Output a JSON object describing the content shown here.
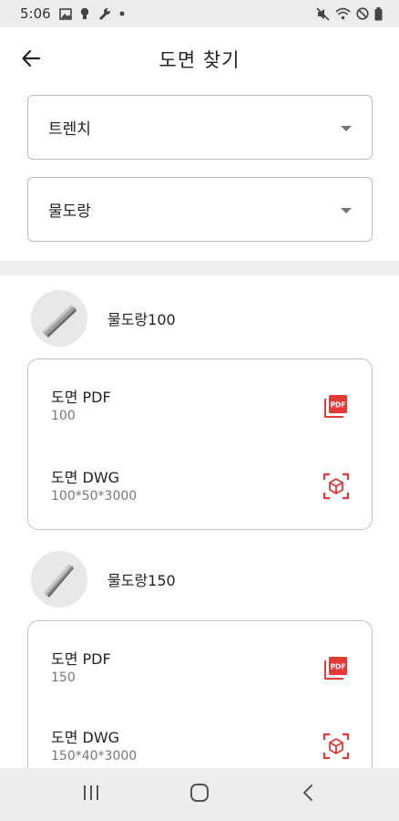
{
  "status": {
    "time": "5:06",
    "left_icons": [
      "image-icon",
      "bulb-icon",
      "wrench-icon",
      "dot-icon"
    ],
    "right_icons": [
      "mute-icon",
      "wifi-icon",
      "dnd-icon",
      "battery-icon"
    ]
  },
  "header": {
    "title": "도면 찾기",
    "back_icon": "arrow-left-icon"
  },
  "filters": {
    "category": "트렌치",
    "subcategory": "물도랑"
  },
  "products": [
    {
      "name": "물도랑100",
      "files": [
        {
          "title": "도면 PDF",
          "spec": "100",
          "icon": "pdf-icon"
        },
        {
          "title": "도면 DWG",
          "spec": "100*50*3000",
          "icon": "cube-icon"
        }
      ]
    },
    {
      "name": "물도랑150",
      "files": [
        {
          "title": "도면 PDF",
          "spec": "150",
          "icon": "pdf-icon"
        },
        {
          "title": "도면 DWG",
          "spec": "150*40*3000",
          "icon": "cube-icon"
        }
      ]
    }
  ],
  "colors": {
    "accent_red": "#e53935",
    "card_border": "#c4c4c4",
    "nav_bg": "#ededed"
  },
  "nav": {
    "icons": [
      "recents-icon",
      "home-icon",
      "back-icon"
    ]
  }
}
